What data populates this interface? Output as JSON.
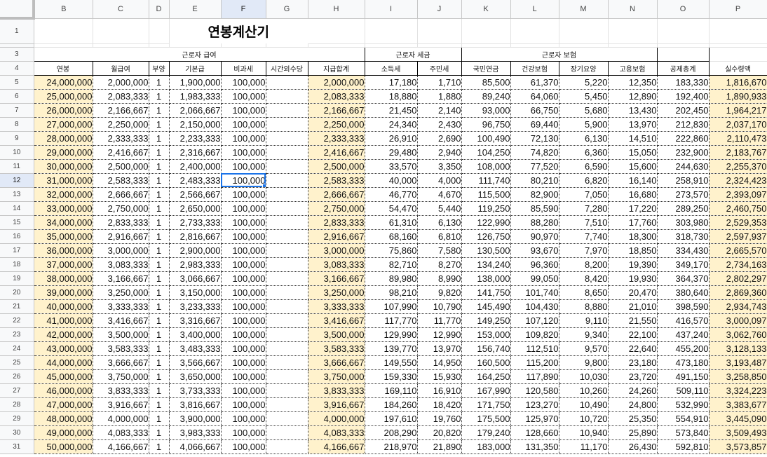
{
  "columns": [
    "",
    "B",
    "C",
    "D",
    "E",
    "F",
    "G",
    "H",
    "I",
    "J",
    "K",
    "L",
    "M",
    "N",
    "O",
    "P"
  ],
  "selected_column": "F",
  "selected_row": "12",
  "title_row": "1",
  "title": "연봉계산기",
  "header_row_1": "3",
  "header_row_2": "4",
  "group_headers": {
    "salary": "근로자 급여",
    "tax": "근로자 세금",
    "insurance": "근로자 보험"
  },
  "headers": [
    "연봉",
    "월급여",
    "부양",
    "기본급",
    "비과세",
    "시간외수당",
    "지급합계",
    "소득세",
    "주민세",
    "국민연금",
    "건강보험",
    "장기요양",
    "고용보험",
    "공제총계",
    "실수령액"
  ],
  "rows": [
    {
      "n": "5",
      "c": [
        "24,000,000",
        "2,000,000",
        "1",
        "1,900,000",
        "100,000",
        "",
        "2,000,000",
        "17,180",
        "1,710",
        "85,500",
        "61,370",
        "5,220",
        "12,350",
        "183,330",
        "1,816,670"
      ]
    },
    {
      "n": "6",
      "c": [
        "25,000,000",
        "2,083,333",
        "1",
        "1,983,333",
        "100,000",
        "",
        "2,083,333",
        "18,880",
        "1,880",
        "89,240",
        "64,060",
        "5,450",
        "12,890",
        "192,400",
        "1,890,933"
      ]
    },
    {
      "n": "7",
      "c": [
        "26,000,000",
        "2,166,667",
        "1",
        "2,066,667",
        "100,000",
        "",
        "2,166,667",
        "21,450",
        "2,140",
        "93,000",
        "66,750",
        "5,680",
        "13,430",
        "202,450",
        "1,964,217"
      ]
    },
    {
      "n": "8",
      "c": [
        "27,000,000",
        "2,250,000",
        "1",
        "2,150,000",
        "100,000",
        "",
        "2,250,000",
        "24,340",
        "2,430",
        "96,750",
        "69,440",
        "5,900",
        "13,970",
        "212,830",
        "2,037,170"
      ]
    },
    {
      "n": "9",
      "c": [
        "28,000,000",
        "2,333,333",
        "1",
        "2,233,333",
        "100,000",
        "",
        "2,333,333",
        "26,910",
        "2,690",
        "100,490",
        "72,130",
        "6,130",
        "14,510",
        "222,860",
        "2,110,473"
      ]
    },
    {
      "n": "10",
      "c": [
        "29,000,000",
        "2,416,667",
        "1",
        "2,316,667",
        "100,000",
        "",
        "2,416,667",
        "29,480",
        "2,940",
        "104,250",
        "74,820",
        "6,360",
        "15,050",
        "232,900",
        "2,183,767"
      ]
    },
    {
      "n": "11",
      "c": [
        "30,000,000",
        "2,500,000",
        "1",
        "2,400,000",
        "100,000",
        "",
        "2,500,000",
        "33,570",
        "3,350",
        "108,000",
        "77,520",
        "6,590",
        "15,600",
        "244,630",
        "2,255,370"
      ]
    },
    {
      "n": "12",
      "c": [
        "31,000,000",
        "2,583,333",
        "1",
        "2,483,333",
        "100,000",
        "",
        "2,583,333",
        "40,000",
        "4,000",
        "111,740",
        "80,210",
        "6,820",
        "16,140",
        "258,910",
        "2,324,423"
      ]
    },
    {
      "n": "13",
      "c": [
        "32,000,000",
        "2,666,667",
        "1",
        "2,566,667",
        "100,000",
        "",
        "2,666,667",
        "46,770",
        "4,670",
        "115,500",
        "82,900",
        "7,050",
        "16,680",
        "273,570",
        "2,393,097"
      ]
    },
    {
      "n": "14",
      "c": [
        "33,000,000",
        "2,750,000",
        "1",
        "2,650,000",
        "100,000",
        "",
        "2,750,000",
        "54,470",
        "5,440",
        "119,250",
        "85,590",
        "7,280",
        "17,220",
        "289,250",
        "2,460,750"
      ]
    },
    {
      "n": "15",
      "c": [
        "34,000,000",
        "2,833,333",
        "1",
        "2,733,333",
        "100,000",
        "",
        "2,833,333",
        "61,310",
        "6,130",
        "122,990",
        "88,280",
        "7,510",
        "17,760",
        "303,980",
        "2,529,353"
      ]
    },
    {
      "n": "16",
      "c": [
        "35,000,000",
        "2,916,667",
        "1",
        "2,816,667",
        "100,000",
        "",
        "2,916,667",
        "68,160",
        "6,810",
        "126,750",
        "90,970",
        "7,740",
        "18,300",
        "318,730",
        "2,597,937"
      ]
    },
    {
      "n": "17",
      "c": [
        "36,000,000",
        "3,000,000",
        "1",
        "2,900,000",
        "100,000",
        "",
        "3,000,000",
        "75,860",
        "7,580",
        "130,500",
        "93,670",
        "7,970",
        "18,850",
        "334,430",
        "2,665,570"
      ]
    },
    {
      "n": "18",
      "c": [
        "37,000,000",
        "3,083,333",
        "1",
        "2,983,333",
        "100,000",
        "",
        "3,083,333",
        "82,710",
        "8,270",
        "134,240",
        "96,360",
        "8,200",
        "19,390",
        "349,170",
        "2,734,163"
      ]
    },
    {
      "n": "19",
      "c": [
        "38,000,000",
        "3,166,667",
        "1",
        "3,066,667",
        "100,000",
        "",
        "3,166,667",
        "89,980",
        "8,990",
        "138,000",
        "99,050",
        "8,420",
        "19,930",
        "364,370",
        "2,802,297"
      ]
    },
    {
      "n": "20",
      "c": [
        "39,000,000",
        "3,250,000",
        "1",
        "3,150,000",
        "100,000",
        "",
        "3,250,000",
        "98,210",
        "9,820",
        "141,750",
        "101,740",
        "8,650",
        "20,470",
        "380,640",
        "2,869,360"
      ]
    },
    {
      "n": "21",
      "c": [
        "40,000,000",
        "3,333,333",
        "1",
        "3,233,333",
        "100,000",
        "",
        "3,333,333",
        "107,990",
        "10,790",
        "145,490",
        "104,430",
        "8,880",
        "21,010",
        "398,590",
        "2,934,743"
      ]
    },
    {
      "n": "22",
      "c": [
        "41,000,000",
        "3,416,667",
        "1",
        "3,316,667",
        "100,000",
        "",
        "3,416,667",
        "117,770",
        "11,770",
        "149,250",
        "107,120",
        "9,110",
        "21,550",
        "416,570",
        "3,000,097"
      ]
    },
    {
      "n": "23",
      "c": [
        "42,000,000",
        "3,500,000",
        "1",
        "3,400,000",
        "100,000",
        "",
        "3,500,000",
        "129,990",
        "12,990",
        "153,000",
        "109,820",
        "9,340",
        "22,100",
        "437,240",
        "3,062,760"
      ]
    },
    {
      "n": "24",
      "c": [
        "43,000,000",
        "3,583,333",
        "1",
        "3,483,333",
        "100,000",
        "",
        "3,583,333",
        "139,770",
        "13,970",
        "156,740",
        "112,510",
        "9,570",
        "22,640",
        "455,200",
        "3,128,133"
      ]
    },
    {
      "n": "25",
      "c": [
        "44,000,000",
        "3,666,667",
        "1",
        "3,566,667",
        "100,000",
        "",
        "3,666,667",
        "149,550",
        "14,950",
        "160,500",
        "115,200",
        "9,800",
        "23,180",
        "473,180",
        "3,193,487"
      ]
    },
    {
      "n": "26",
      "c": [
        "45,000,000",
        "3,750,000",
        "1",
        "3,650,000",
        "100,000",
        "",
        "3,750,000",
        "159,330",
        "15,930",
        "164,250",
        "117,890",
        "10,030",
        "23,720",
        "491,150",
        "3,258,850"
      ]
    },
    {
      "n": "27",
      "c": [
        "46,000,000",
        "3,833,333",
        "1",
        "3,733,333",
        "100,000",
        "",
        "3,833,333",
        "169,110",
        "16,910",
        "167,990",
        "120,580",
        "10,260",
        "24,260",
        "509,110",
        "3,324,223"
      ]
    },
    {
      "n": "28",
      "c": [
        "47,000,000",
        "3,916,667",
        "1",
        "3,816,667",
        "100,000",
        "",
        "3,916,667",
        "184,260",
        "18,420",
        "171,750",
        "123,270",
        "10,490",
        "24,800",
        "532,990",
        "3,383,677"
      ]
    },
    {
      "n": "29",
      "c": [
        "48,000,000",
        "4,000,000",
        "1",
        "3,900,000",
        "100,000",
        "",
        "4,000,000",
        "197,610",
        "19,760",
        "175,500",
        "125,970",
        "10,720",
        "25,350",
        "554,910",
        "3,445,090"
      ]
    },
    {
      "n": "30",
      "c": [
        "49,000,000",
        "4,083,333",
        "1",
        "3,983,333",
        "100,000",
        "",
        "4,083,333",
        "208,290",
        "20,820",
        "179,240",
        "128,660",
        "10,940",
        "25,890",
        "573,840",
        "3,509,493"
      ]
    },
    {
      "n": "31",
      "c": [
        "50,000,000",
        "4,166,667",
        "1",
        "4,066,667",
        "100,000",
        "",
        "4,166,667",
        "218,970",
        "21,890",
        "183,000",
        "131,350",
        "11,170",
        "26,430",
        "592,810",
        "3,573,857"
      ]
    }
  ]
}
